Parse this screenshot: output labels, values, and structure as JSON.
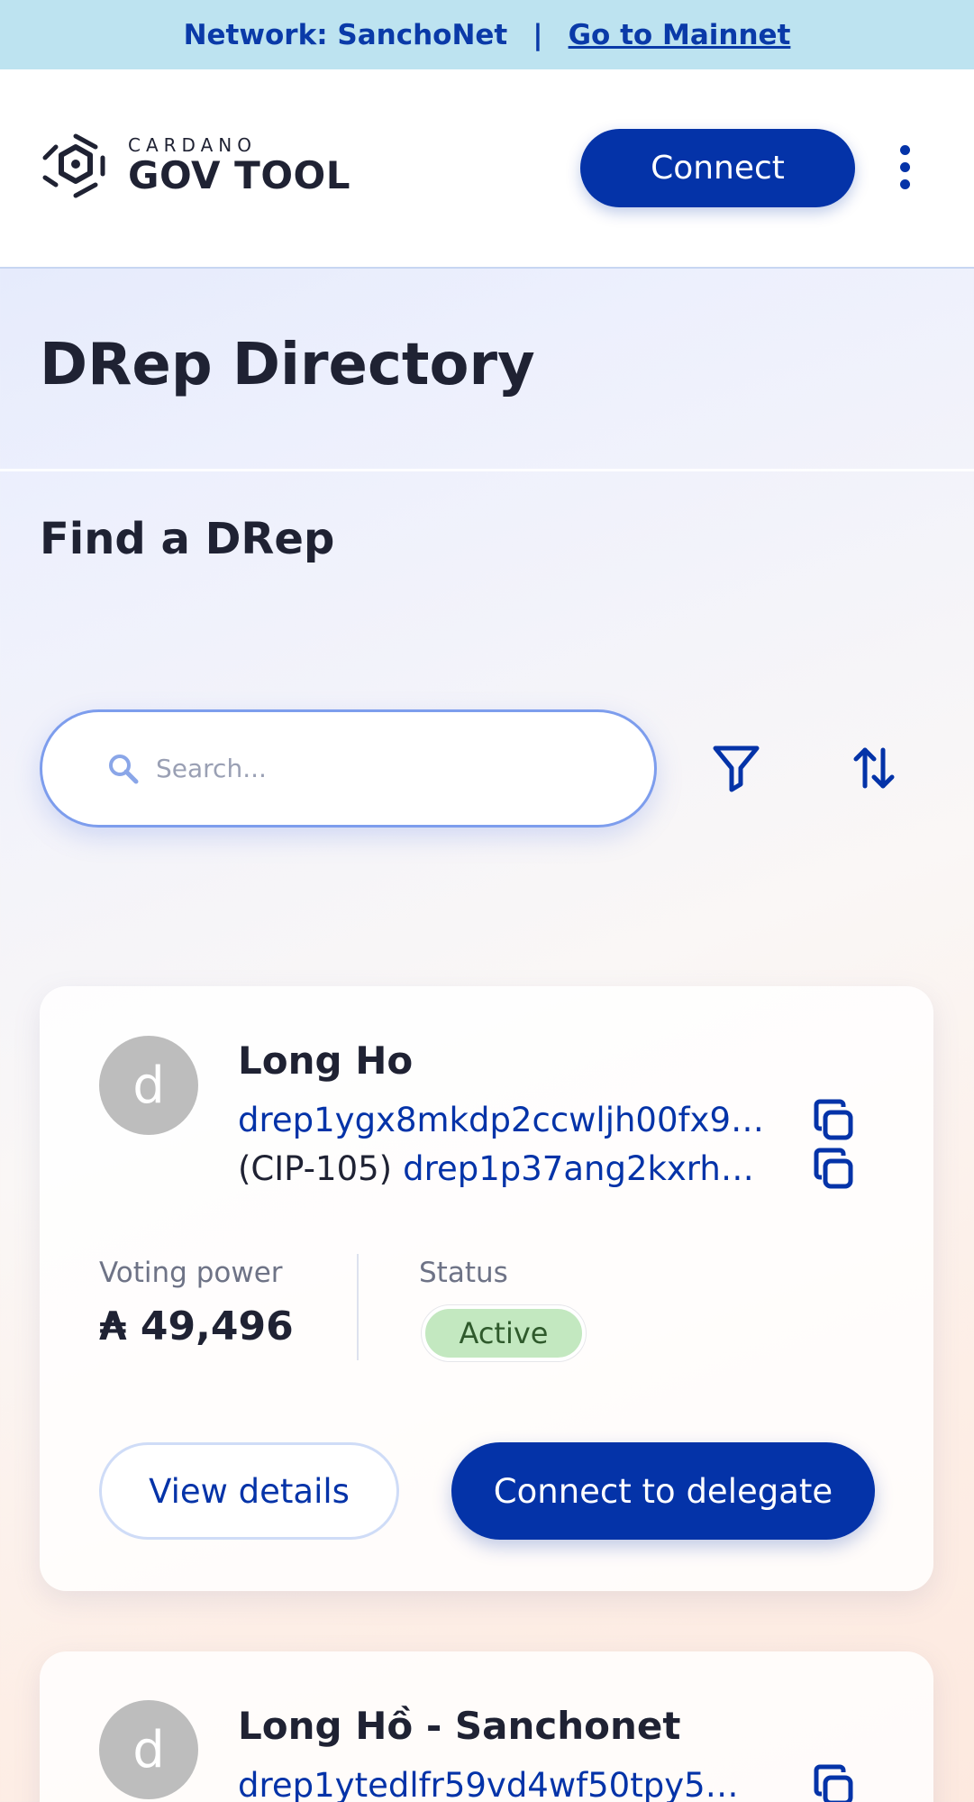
{
  "banner": {
    "network_text": "Network: SanchoNet",
    "separator": "|",
    "mainnet_link": "Go to Mainnet"
  },
  "header": {
    "logo_small": "CARDANO",
    "logo_big": "GOV TOOL",
    "connect_label": "Connect",
    "menu_icon": "more-vertical-icon"
  },
  "page": {
    "title": "DRep Directory",
    "section_title": "Find a DRep"
  },
  "search": {
    "placeholder": "Search...",
    "value": "",
    "icon": "search-icon",
    "filter_icon": "filter-icon",
    "sort_icon": "sort-icon"
  },
  "colors": {
    "brand": "#0433a8",
    "banner_bg": "#bde3f0",
    "status_active_bg": "#c3e8c0",
    "status_active_text": "#2f5a2c"
  },
  "dreps": [
    {
      "avatar_letter": "d",
      "name": "Long Ho",
      "drep_id": "drep1ygx8mkdp2ccwljh00fx9…",
      "cip_prefix": "(CIP-105)",
      "cip105_id": "drep1p37ang2kxrh…",
      "voting_power_label": "Voting power",
      "voting_power_value": "₳ 49,496",
      "status_label": "Status",
      "status": "Active",
      "view_details_label": "View details",
      "delegate_label": "Connect to delegate"
    },
    {
      "avatar_letter": "d",
      "name": "Long Hồ - Sanchonet",
      "drep_id": "drep1ytedlfr59vd4wf50tpy5…"
    }
  ]
}
